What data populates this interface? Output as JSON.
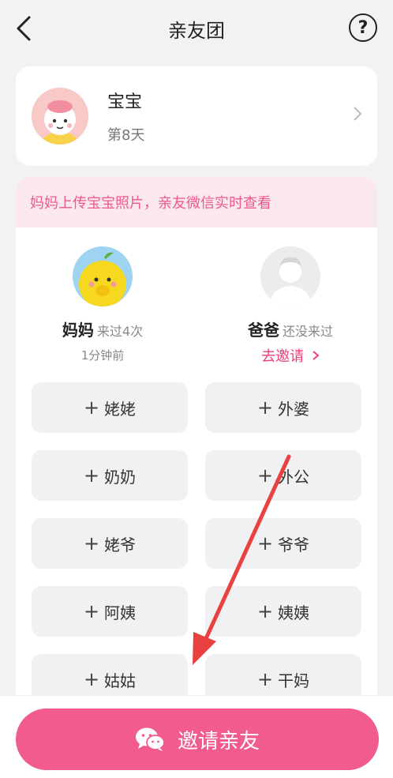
{
  "header": {
    "title": "亲友团",
    "help_label": "?"
  },
  "baby": {
    "name": "宝宝",
    "age": "第8天"
  },
  "banner": {
    "text": "妈妈上传宝宝照片，亲友微信实时查看"
  },
  "members": [
    {
      "name": "妈妈",
      "status": "来过4次",
      "sub": "1分钟前"
    },
    {
      "name": "爸爸",
      "status": "还没来过",
      "invite": "去邀请"
    }
  ],
  "roles": [
    "姥姥",
    "外婆",
    "奶奶",
    "外公",
    "姥爷",
    "爷爷",
    "阿姨",
    "姨姨",
    "姑姑",
    "干妈"
  ],
  "invite_button": {
    "label": "邀请亲友"
  },
  "colors": {
    "accent": "#f15c8c",
    "banner_bg": "#fbe7ee",
    "banner_text": "#ee5a8a",
    "annotation_arrow": "#e8413f"
  }
}
